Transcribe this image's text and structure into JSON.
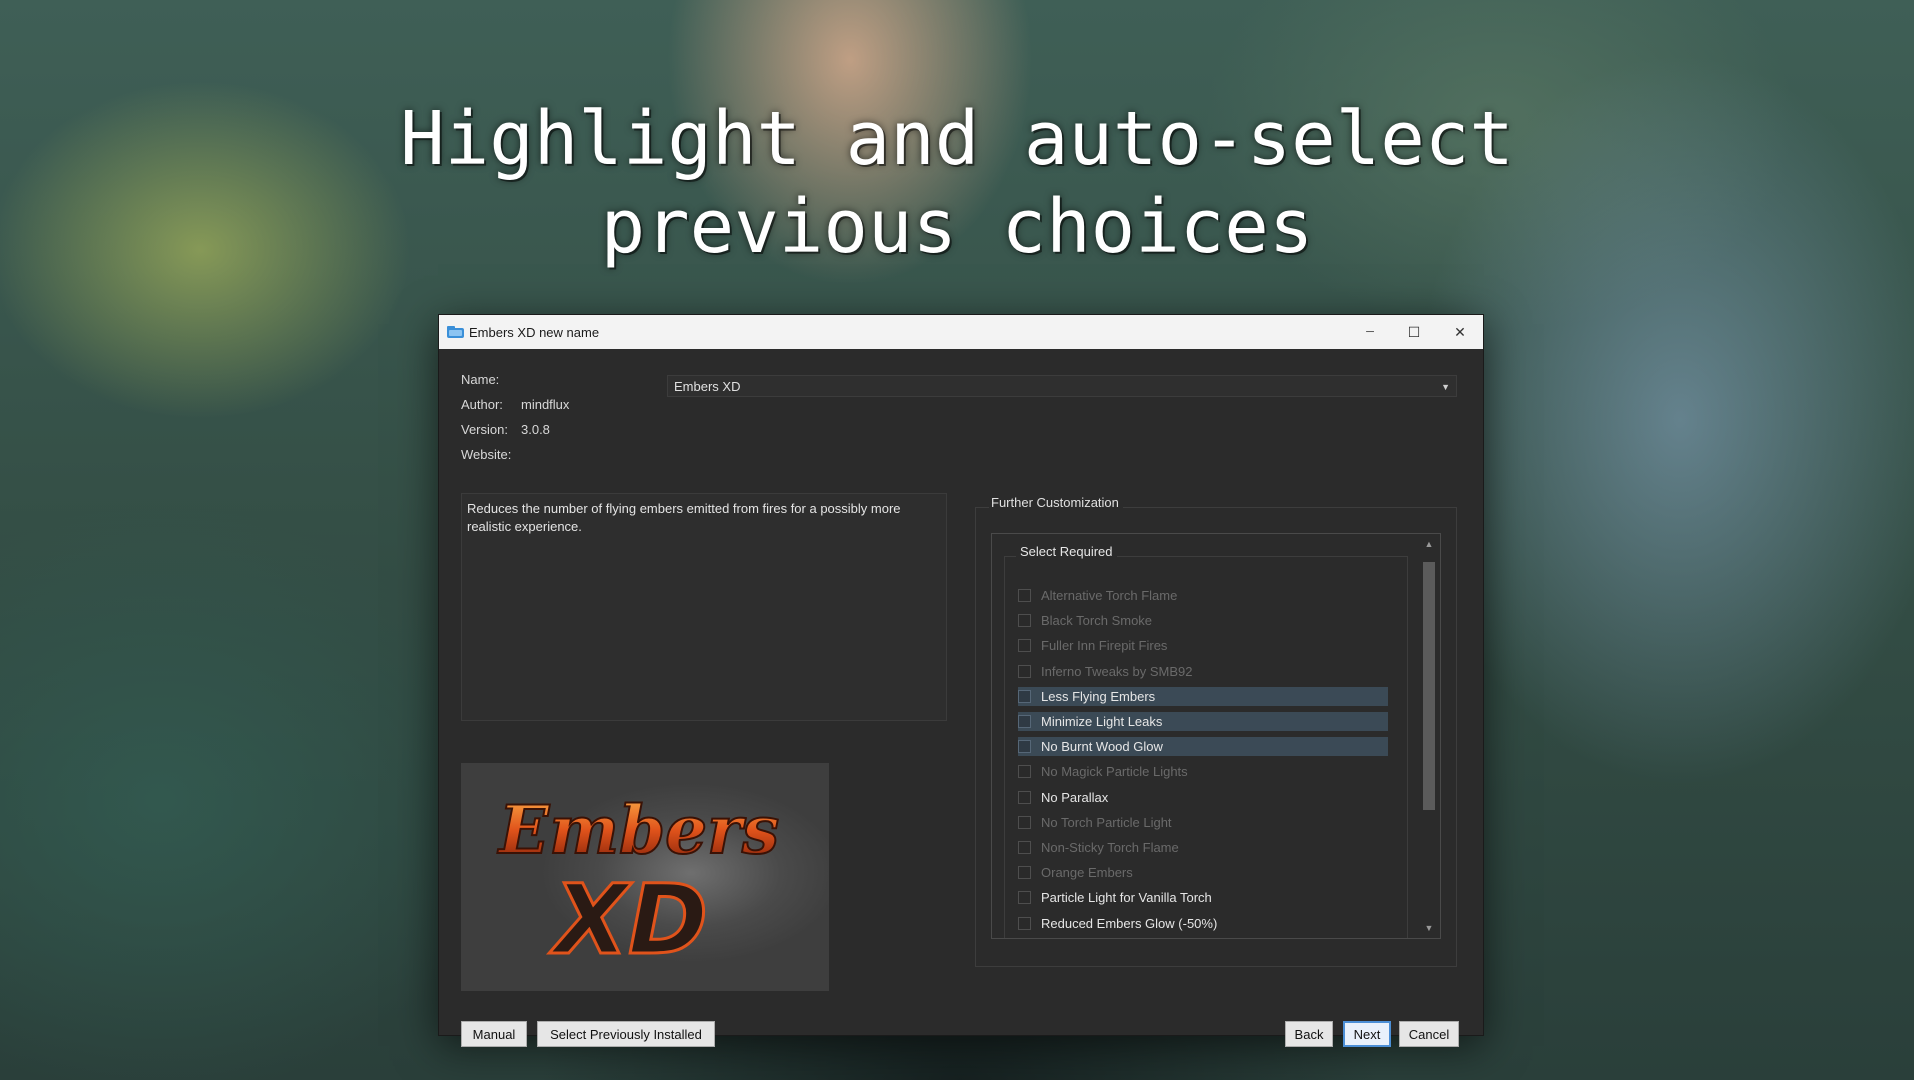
{
  "headline": "Highlight and auto-select\nprevious choices",
  "window": {
    "title": "Embers XD new name",
    "minimize": "─",
    "maximize": "☐",
    "close": "✕"
  },
  "info": {
    "name_label": "Name:",
    "author_label": "Author:",
    "author": "mindflux",
    "version_label": "Version:",
    "version": "3.0.8",
    "website_label": "Website:",
    "name_value": "Embers XD"
  },
  "description": "Reduces the number of flying embers emitted from fires for a possibly more realistic experience.",
  "preview": {
    "line1": "Embers",
    "line2": "XD"
  },
  "further": {
    "title": "Further Customization",
    "group_title": "Select Required",
    "options": [
      {
        "label": "Alternative Torch Flame",
        "state": "disabled"
      },
      {
        "label": "Black Torch Smoke",
        "state": "disabled"
      },
      {
        "label": "Fuller Inn Firepit Fires",
        "state": "disabled"
      },
      {
        "label": "Inferno Tweaks by SMB92",
        "state": "disabled"
      },
      {
        "label": "Less Flying Embers",
        "state": "highlighted"
      },
      {
        "label": "Minimize Light Leaks",
        "state": "highlighted"
      },
      {
        "label": "No Burnt Wood Glow",
        "state": "highlighted"
      },
      {
        "label": "No Magick Particle Lights",
        "state": "disabled"
      },
      {
        "label": "No Parallax",
        "state": "enabled"
      },
      {
        "label": "No Torch Particle Light",
        "state": "disabled"
      },
      {
        "label": "Non-Sticky Torch Flame",
        "state": "disabled"
      },
      {
        "label": "Orange Embers",
        "state": "disabled"
      },
      {
        "label": "Particle Light for Vanilla Torch",
        "state": "enabled"
      },
      {
        "label": "Reduced Embers Glow (-50%)",
        "state": "enabled"
      }
    ]
  },
  "buttons": {
    "manual": "Manual",
    "select_prev": "Select Previously Installed",
    "back": "Back",
    "next": "Next",
    "cancel": "Cancel"
  },
  "colors": {
    "highlight_row": "#3b4a56",
    "default_button_border": "#4c8fd6"
  }
}
